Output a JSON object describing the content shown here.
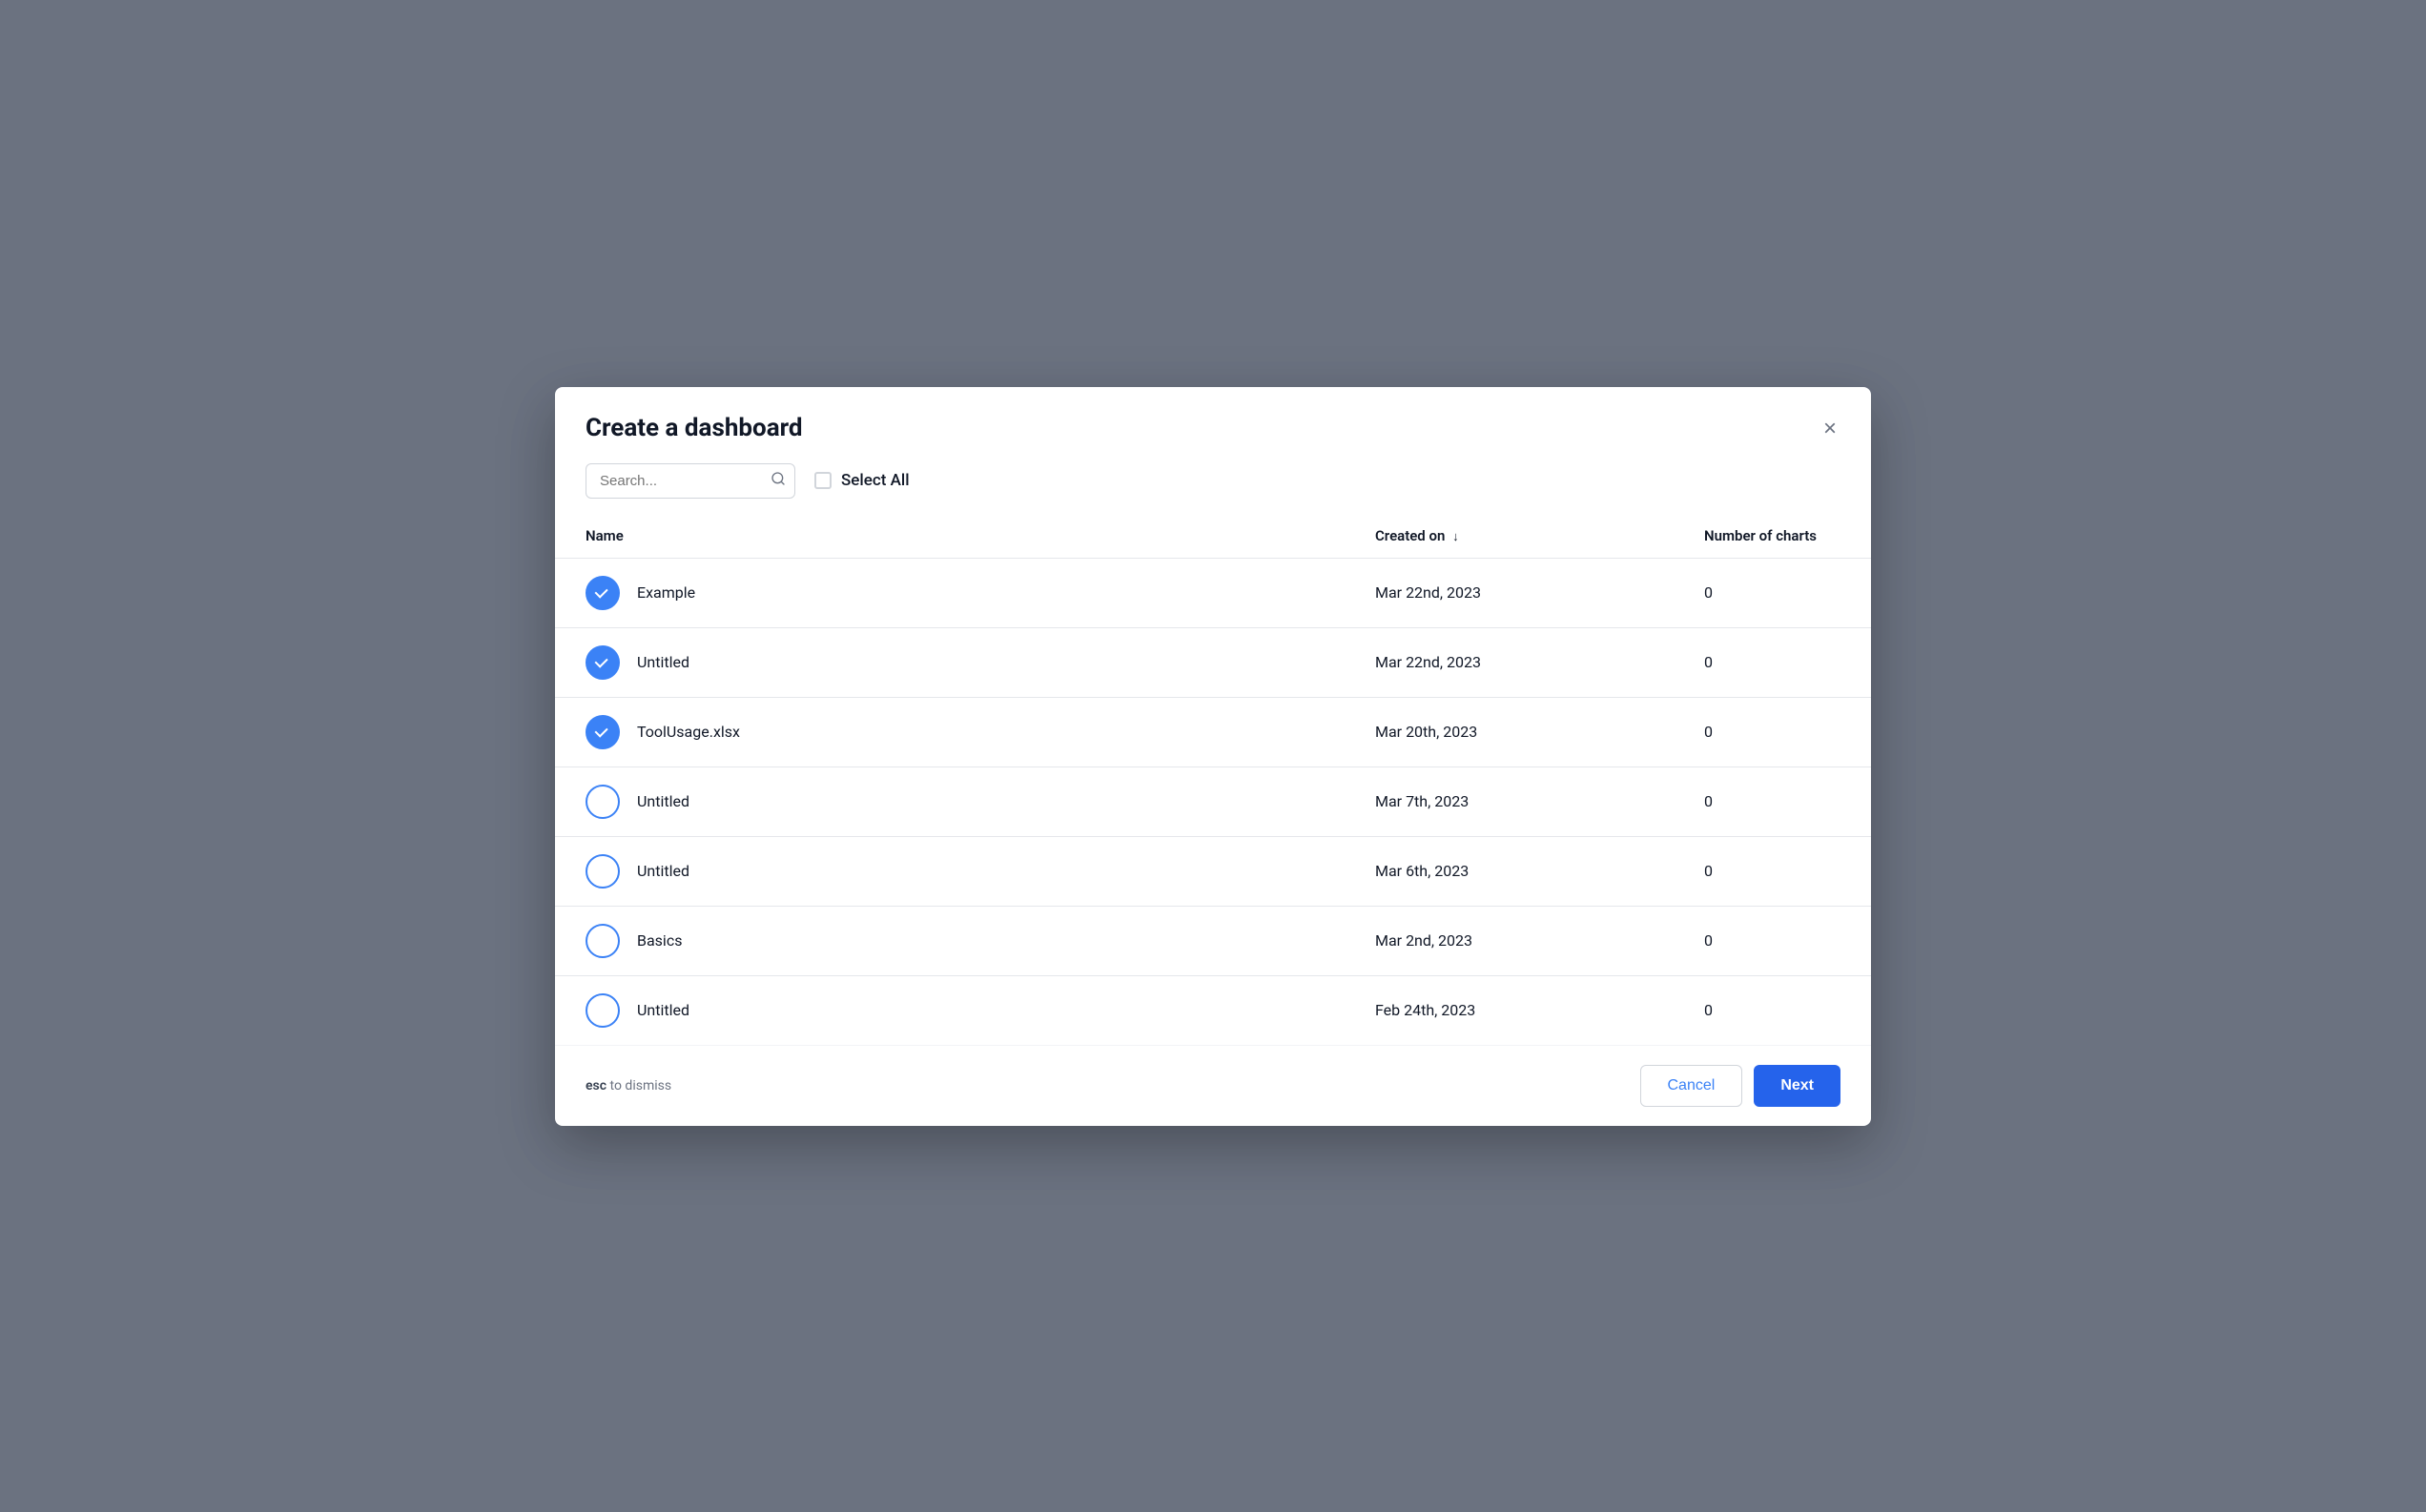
{
  "modal": {
    "title": "Create a dashboard",
    "close_label": "×"
  },
  "toolbar": {
    "search_placeholder": "Search...",
    "select_all_label": "Select All"
  },
  "table": {
    "columns": {
      "name": "Name",
      "created_on": "Created on",
      "num_charts": "Number of charts"
    },
    "rows": [
      {
        "id": 1,
        "name": "Example",
        "created": "Mar 22nd, 2023",
        "charts": "0",
        "checked": true
      },
      {
        "id": 2,
        "name": "Untitled",
        "created": "Mar 22nd, 2023",
        "charts": "0",
        "checked": true
      },
      {
        "id": 3,
        "name": "ToolUsage.xlsx",
        "created": "Mar 20th, 2023",
        "charts": "0",
        "checked": true
      },
      {
        "id": 4,
        "name": "Untitled",
        "created": "Mar 7th, 2023",
        "charts": "0",
        "checked": false
      },
      {
        "id": 5,
        "name": "Untitled",
        "created": "Mar 6th, 2023",
        "charts": "0",
        "checked": false
      },
      {
        "id": 6,
        "name": "Basics",
        "created": "Mar 2nd, 2023",
        "charts": "0",
        "checked": false
      },
      {
        "id": 7,
        "name": "Untitled",
        "created": "Feb 24th, 2023",
        "charts": "0",
        "checked": false
      }
    ]
  },
  "footer": {
    "esc_label": "esc",
    "dismiss_label": "to dismiss",
    "cancel_label": "Cancel",
    "next_label": "Next"
  }
}
